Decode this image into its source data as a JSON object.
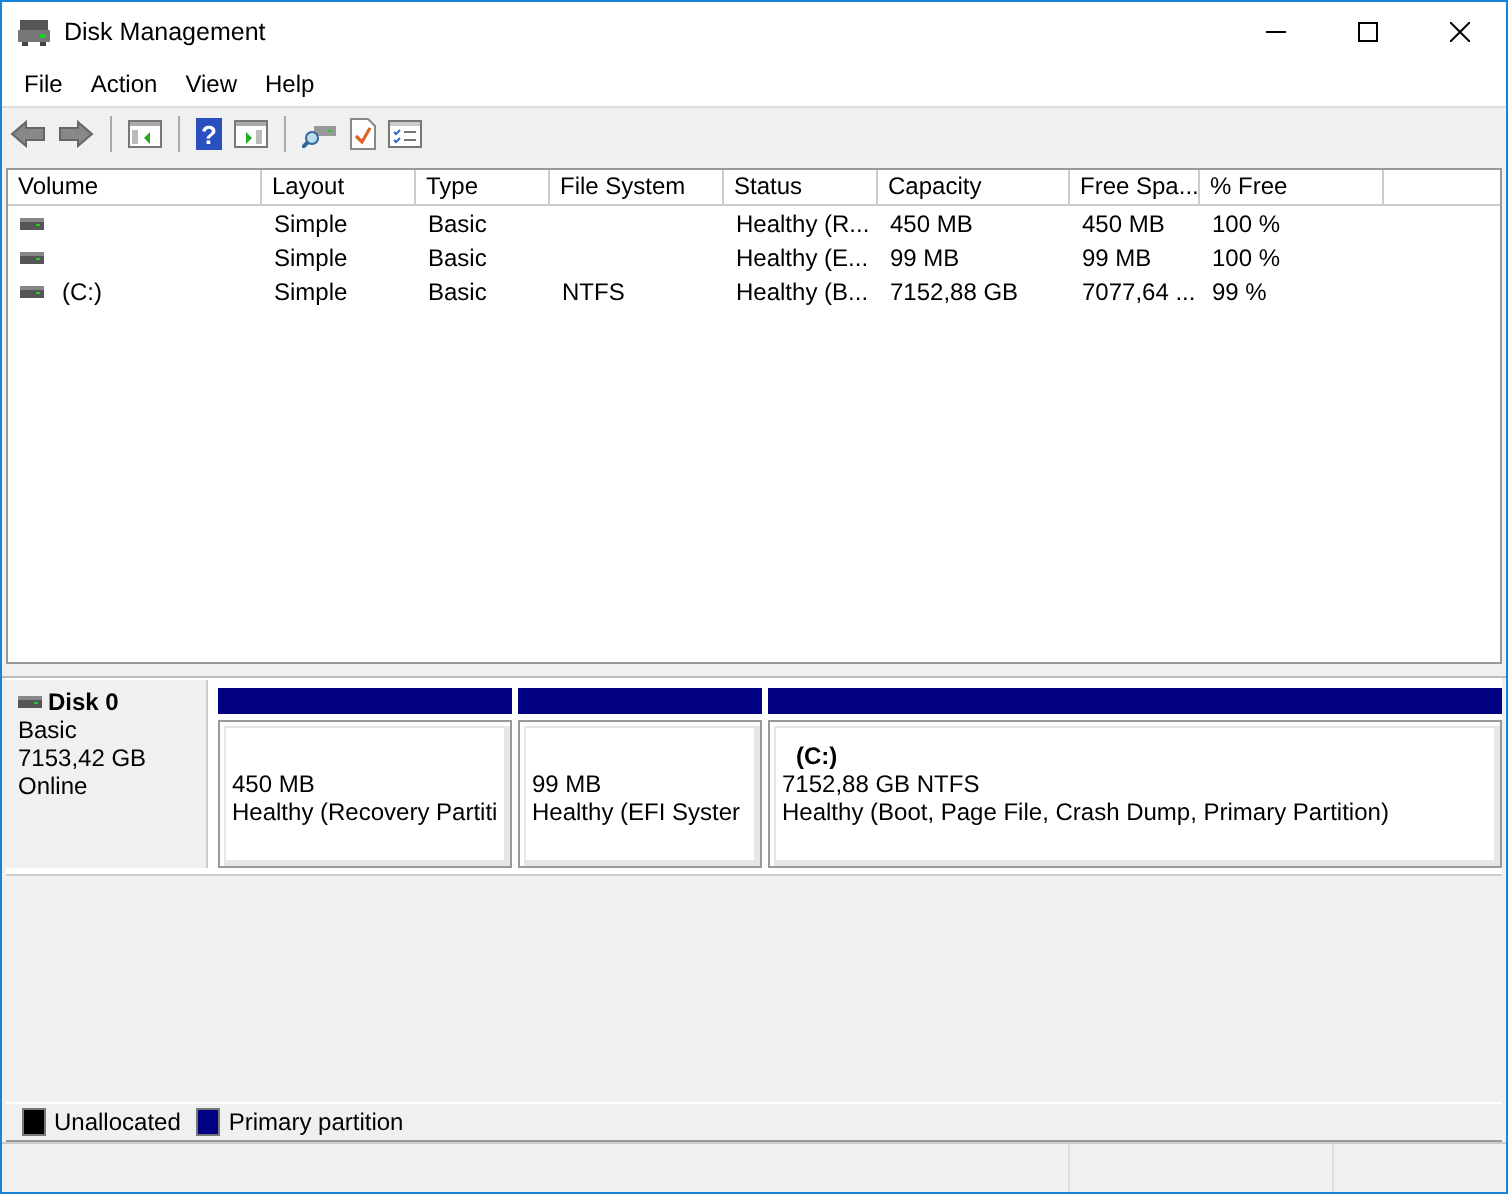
{
  "window": {
    "title": "Disk Management"
  },
  "menu": [
    "File",
    "Action",
    "View",
    "Help"
  ],
  "toolbar": {
    "help_glyph": "?"
  },
  "volume_list": {
    "columns": [
      "Volume",
      "Layout",
      "Type",
      "File System",
      "Status",
      "Capacity",
      "Free Spa...",
      "% Free"
    ],
    "rows": [
      [
        "",
        "Simple",
        "Basic",
        "",
        "Healthy (R...",
        "450 MB",
        "450 MB",
        "100 %"
      ],
      [
        "",
        "Simple",
        "Basic",
        "",
        "Healthy (E...",
        "99 MB",
        "99 MB",
        "100 %"
      ],
      [
        "(C:)",
        "Simple",
        "Basic",
        "NTFS",
        "Healthy (B...",
        "7152,88 GB",
        "7077,64 ...",
        "99 %"
      ]
    ]
  },
  "disks": [
    {
      "name": "Disk 0",
      "type": "Basic",
      "size": "7153,42 GB",
      "status": "Online",
      "partitions": [
        {
          "size": "450 MB",
          "status": "Healthy (Recovery Partiti",
          "color": "#000080"
        },
        {
          "size": "99 MB",
          "status": "Healthy (EFI Syster",
          "color": "#000080"
        },
        {
          "label": "(C:)",
          "size": "7152,88 GB NTFS",
          "status": "Healthy (Boot, Page File, Crash Dump, Primary Partition)",
          "color": "#000080"
        }
      ]
    }
  ],
  "legend": [
    {
      "label": "Unallocated",
      "color": "#000000"
    },
    {
      "label": "Primary partition",
      "color": "#000080"
    }
  ]
}
